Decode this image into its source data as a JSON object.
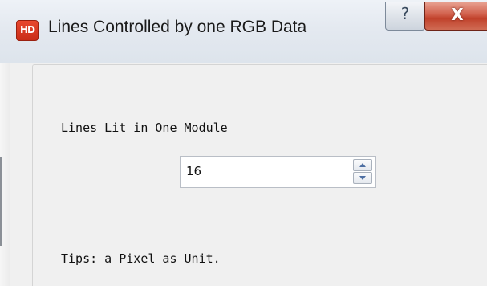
{
  "window": {
    "title": "Lines Controlled by one RGB Data",
    "app_icon_text": "HD",
    "app_icon_color": "#d8371f",
    "help_glyph": "?",
    "close_glyph": "X",
    "close_color": "#c7432c"
  },
  "form": {
    "lines_label": "Lines Lit in One Module",
    "lines_value": "16",
    "tips": "Tips: a Pixel as Unit."
  },
  "icons": {
    "app": "hd-logo-icon",
    "help": "help-icon",
    "close": "close-icon",
    "spin_up": "triangle-up-icon",
    "spin_down": "triangle-down-icon"
  }
}
